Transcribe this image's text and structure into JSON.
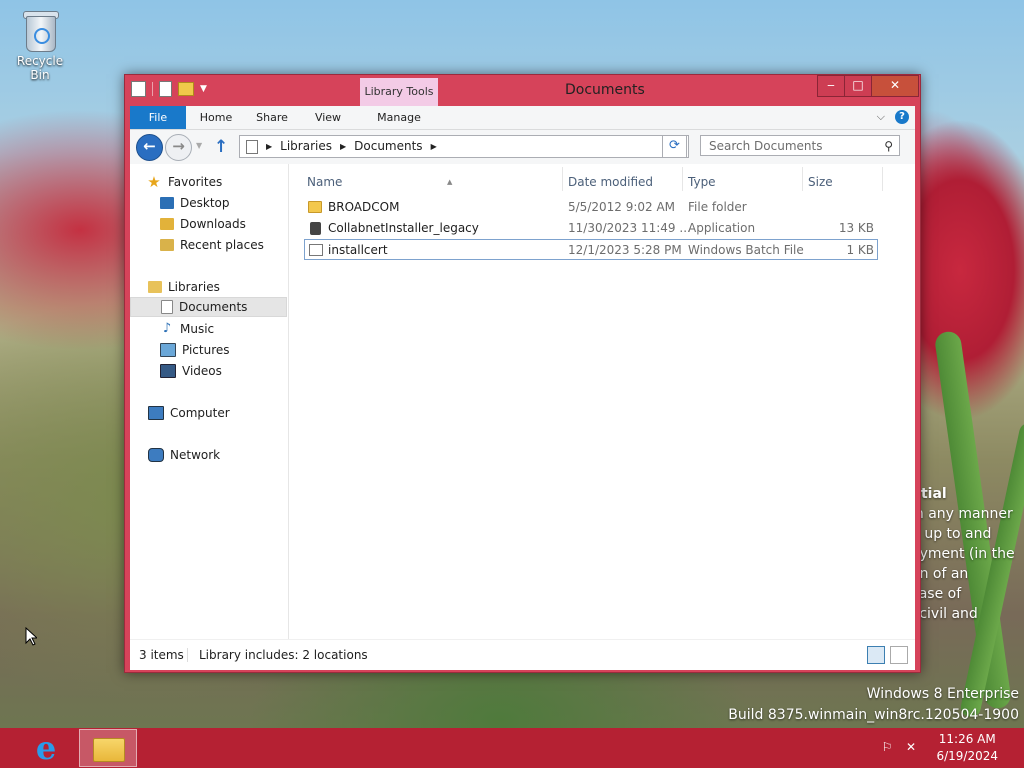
{
  "desktop": {
    "recycle_bin_label": "Recycle Bin",
    "watermark_lines": [
      "ntial",
      "in any manner",
      "n up to and",
      "oyment (in the",
      "on of an",
      "case of",
      "l civil and"
    ],
    "build_lines": [
      "Windows 8 Enterprise",
      "Build 8375.winmain_win8rc.120504-1900"
    ]
  },
  "window": {
    "title": "Documents",
    "contextual_tab_group": "Library Tools",
    "controls": {
      "minimize": "‒",
      "maximize": "□",
      "close": "✕"
    },
    "ribbon_tabs": {
      "file": "File",
      "home": "Home",
      "share": "Share",
      "view": "View",
      "manage": "Manage"
    },
    "address": {
      "crumb_1": "Libraries",
      "crumb_2": "Documents"
    },
    "search": {
      "placeholder": "Search Documents"
    }
  },
  "nav_pane": {
    "favorites": "Favorites",
    "desktop": "Desktop",
    "downloads": "Downloads",
    "recent_places": "Recent places",
    "libraries": "Libraries",
    "documents": "Documents",
    "music": "Music",
    "pictures": "Pictures",
    "videos": "Videos",
    "computer": "Computer",
    "network": "Network"
  },
  "file_list": {
    "columns": {
      "name": "Name",
      "date": "Date modified",
      "type": "Type",
      "size": "Size"
    },
    "rows": [
      {
        "name": "BROADCOM",
        "date": "5/5/2012 9:02 AM",
        "type": "File folder",
        "size": ""
      },
      {
        "name": "CollabnetInstaller_legacy",
        "date": "11/30/2023 11:49 ...",
        "type": "Application",
        "size": "13 KB"
      },
      {
        "name": "installcert",
        "date": "12/1/2023 5:28 PM",
        "type": "Windows Batch File",
        "size": "1 KB"
      }
    ]
  },
  "status_bar": {
    "item_count": "3 items",
    "library_info": "Library includes: 2 locations"
  },
  "taskbar": {
    "time": "11:26 AM",
    "date": "6/19/2024"
  }
}
